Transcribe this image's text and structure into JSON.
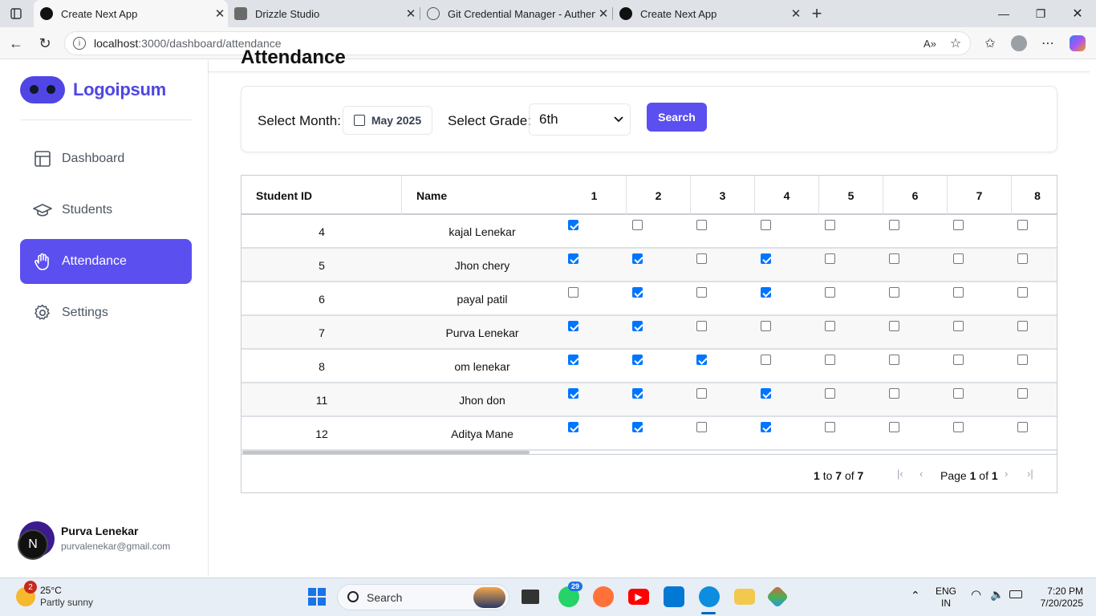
{
  "browser": {
    "tabs": [
      {
        "title": "Create Next App",
        "active": true
      },
      {
        "title": "Drizzle Studio",
        "active": false
      },
      {
        "title": "Git Credential Manager - Authent",
        "active": false
      },
      {
        "title": "Create Next App",
        "active": false
      }
    ],
    "url_host": "localhost",
    "url_path": ":3000/dashboard/attendance"
  },
  "sidebar": {
    "logo_text": "Logoipsum",
    "items": [
      {
        "label": "Dashboard",
        "icon": "layout-icon",
        "active": false
      },
      {
        "label": "Students",
        "icon": "graduation-cap-icon",
        "active": false
      },
      {
        "label": "Attendance",
        "icon": "hand-icon",
        "active": true
      },
      {
        "label": "Settings",
        "icon": "gear-icon",
        "active": false
      }
    ],
    "user": {
      "initial": "N",
      "name": "Purva Lenekar",
      "email": "purvalenekar@gmail.com"
    }
  },
  "page": {
    "title": "Attendance",
    "filter": {
      "month_label": "Select Month:",
      "month_value": "May 2025",
      "grade_label": "Select Grade:",
      "grade_value": "6th",
      "search_label": "Search"
    }
  },
  "table": {
    "headers": {
      "id": "Student ID",
      "name": "Name",
      "days": [
        "1",
        "2",
        "3",
        "4",
        "5",
        "6",
        "7",
        "8"
      ]
    },
    "rows": [
      {
        "id": "4",
        "name": "kajal Lenekar",
        "days": [
          true,
          false,
          false,
          false,
          false,
          false,
          false,
          false
        ]
      },
      {
        "id": "5",
        "name": "Jhon chery",
        "days": [
          true,
          true,
          false,
          true,
          false,
          false,
          false,
          false
        ]
      },
      {
        "id": "6",
        "name": "payal patil",
        "days": [
          false,
          true,
          false,
          true,
          false,
          false,
          false,
          false
        ]
      },
      {
        "id": "7",
        "name": "Purva Lenekar",
        "days": [
          true,
          true,
          false,
          false,
          false,
          false,
          false,
          false
        ]
      },
      {
        "id": "8",
        "name": "om lenekar",
        "days": [
          true,
          true,
          true,
          false,
          false,
          false,
          false,
          false
        ]
      },
      {
        "id": "11",
        "name": "Jhon don",
        "days": [
          true,
          true,
          false,
          true,
          false,
          false,
          false,
          false
        ]
      },
      {
        "id": "12",
        "name": "Aditya Mane",
        "days": [
          true,
          true,
          false,
          true,
          false,
          false,
          false,
          false
        ]
      }
    ],
    "footer": {
      "range_from": "1",
      "range_to_word": "to",
      "range_to": "7",
      "range_of_word": "of",
      "total": "7",
      "page_word": "Page",
      "page": "1",
      "page_of_word": "of",
      "pages": "1"
    }
  },
  "taskbar": {
    "weather_badge": "2",
    "temperature": "25°C",
    "condition": "Partly sunny",
    "search_label": "Search",
    "whatsapp_badge": "29",
    "lang_top": "ENG",
    "lang_bottom": "IN",
    "time": "7:20 PM",
    "date": "7/20/2025"
  },
  "colors": {
    "accent": "#5b4ff0",
    "checkbox": "#0075ff",
    "logo": "#4f46e5"
  }
}
